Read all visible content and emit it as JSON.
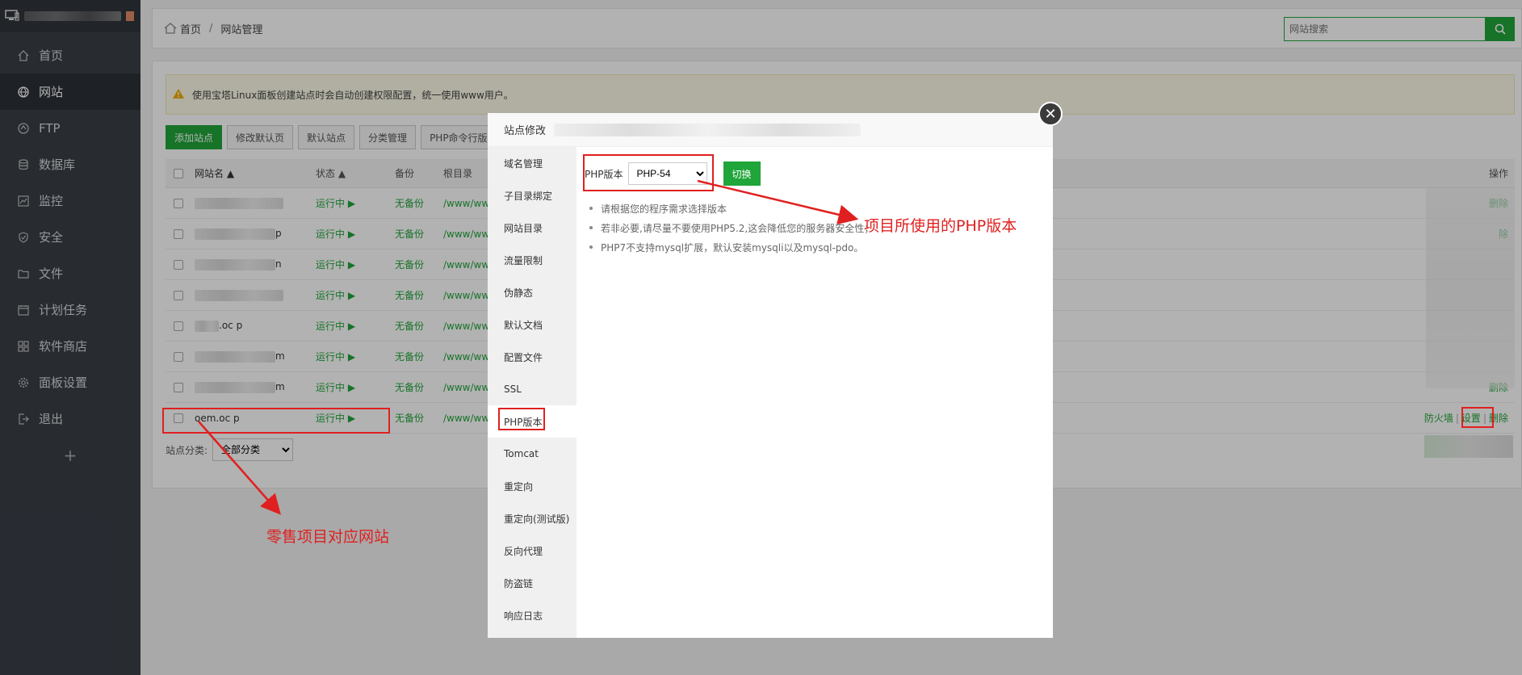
{
  "sidebar": {
    "items": [
      {
        "label": "首页",
        "icon": "home-icon"
      },
      {
        "label": "网站",
        "icon": "globe-icon",
        "active": true
      },
      {
        "label": "FTP",
        "icon": "ftp-icon"
      },
      {
        "label": "数据库",
        "icon": "database-icon"
      },
      {
        "label": "监控",
        "icon": "monitor-icon"
      },
      {
        "label": "安全",
        "icon": "shield-icon"
      },
      {
        "label": "文件",
        "icon": "folder-icon"
      },
      {
        "label": "计划任务",
        "icon": "calendar-icon"
      },
      {
        "label": "软件商店",
        "icon": "grid-icon"
      },
      {
        "label": "面板设置",
        "icon": "gear-icon"
      },
      {
        "label": "退出",
        "icon": "logout-icon"
      }
    ],
    "add_label": "+"
  },
  "header": {
    "home": "首页",
    "separator": "/",
    "current": "网站管理",
    "search_placeholder": "网站搜索"
  },
  "notice": "使用宝塔Linux面板创建站点时会自动创建权限配置，统一使用www用户。",
  "toolbar": {
    "add_site": "添加站点",
    "edit_default_page": "修改默认页",
    "default_site": "默认站点",
    "category_manage": "分类管理",
    "php_cli": "PHP命令行版本"
  },
  "table": {
    "headers": {
      "name": "网站名",
      "status": "状态",
      "backup": "备份",
      "root": "根目录",
      "op": "操作"
    },
    "rows": [
      {
        "name": "",
        "status": "运行中 ▶",
        "backup": "无备份",
        "root": "/www/ww",
        "op": "删除"
      },
      {
        "name": "p",
        "status": "运行中 ▶",
        "backup": "无备份",
        "root": "/www/ww",
        "op": "除"
      },
      {
        "name": "n",
        "status": "运行中 ▶",
        "backup": "无备份",
        "root": "/www/ww",
        "op": ""
      },
      {
        "name": "",
        "status": "运行中 ▶",
        "backup": "无备份",
        "root": "/www/ww",
        "op": ""
      },
      {
        "name": ".oc p",
        "status": "运行中 ▶",
        "backup": "无备份",
        "root": "/www/ww",
        "op": ""
      },
      {
        "name": "m",
        "status": "运行中 ▶",
        "backup": "无备份",
        "root": "/www/ww",
        "op": ""
      },
      {
        "name": "m",
        "status": "运行中 ▶",
        "backup": "无备份",
        "root": "/www/ww",
        "op": "删除"
      },
      {
        "name": "oem.oc        p",
        "status": "运行中 ▶",
        "backup": "无备份",
        "root": "/www/ww",
        "op_firewall": "防火墙",
        "op_settings": "设置",
        "op_delete": "删除"
      }
    ]
  },
  "filter": {
    "label": "站点分类:",
    "selected": "全部分类"
  },
  "modal": {
    "title": "站点修改",
    "close": "✕",
    "menu": [
      "域名管理",
      "子目录绑定",
      "网站目录",
      "流量限制",
      "伪静态",
      "默认文档",
      "配置文件",
      "SSL",
      "PHP版本",
      "Tomcat",
      "重定向",
      "重定向(测试版)",
      "反向代理",
      "防盗链",
      "响应日志"
    ],
    "active_menu": "PHP版本",
    "php_label": "PHP版本",
    "php_selected": "PHP-54",
    "switch_label": "切换",
    "tips": [
      "请根据您的程序需求选择版本",
      "若非必要,请尽量不要使用PHP5.2,这会降低您的服务器安全性；",
      "PHP7不支持mysql扩展，默认安装mysqli以及mysql-pdo。"
    ]
  },
  "annotations": {
    "php_version_note": "项目所使用的PHP版本",
    "site_note": "零售项目对应网站",
    "color": "#e02020"
  },
  "colors": {
    "brand_green": "#20a53a",
    "sidebar_bg": "#3a3f47"
  }
}
